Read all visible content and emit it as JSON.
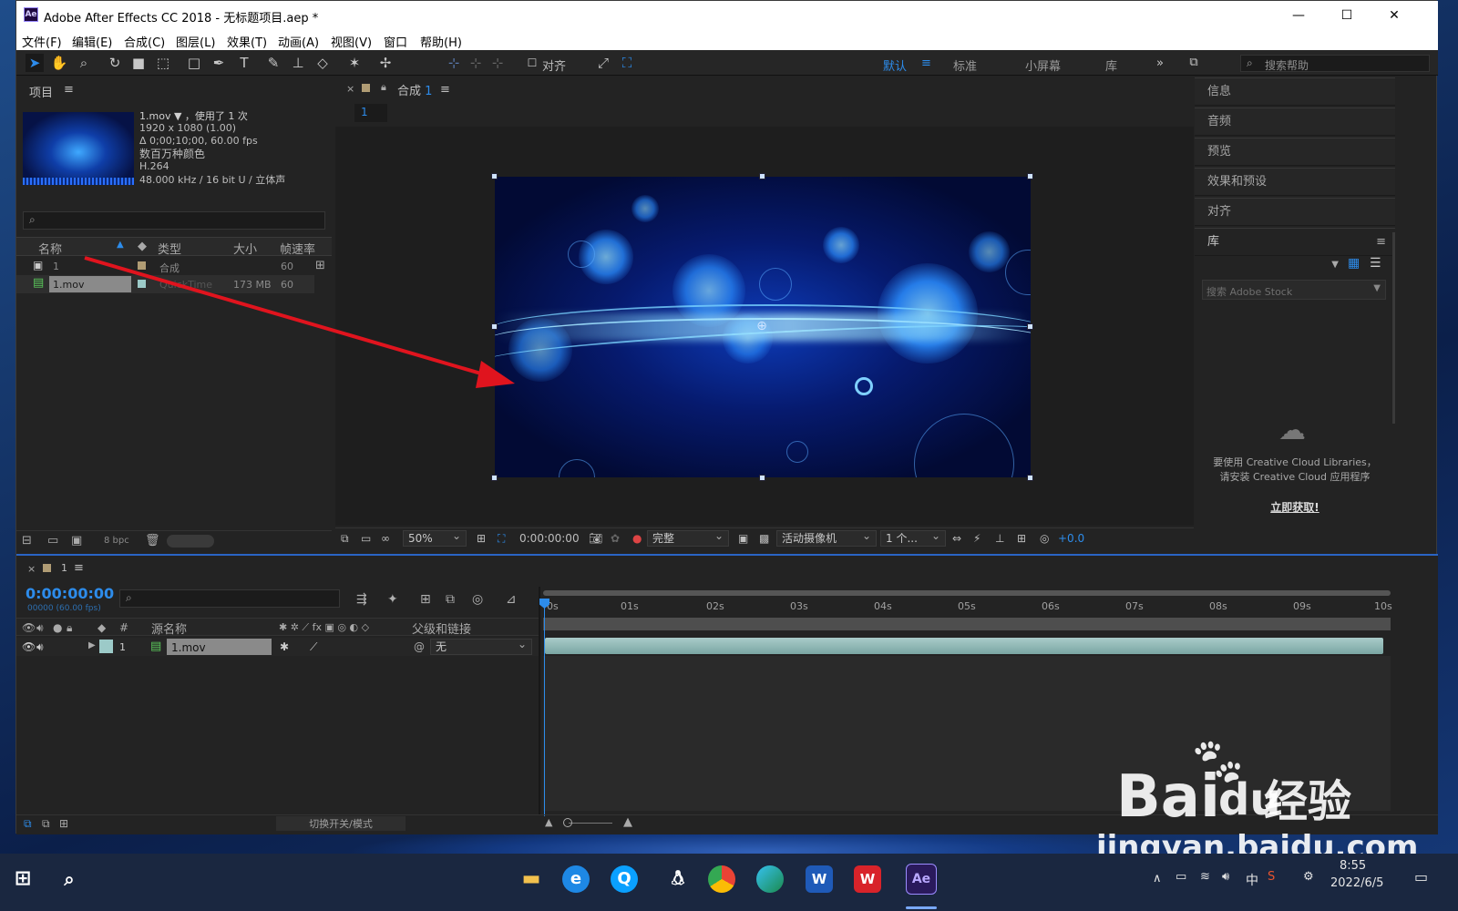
{
  "window": {
    "title": "Adobe After Effects CC 2018 - 无标题项目.aep *",
    "logo_text": "Ae",
    "controls": {
      "minimize": "—",
      "maximize": "☐",
      "close": "✕"
    }
  },
  "menu": [
    "文件(F)",
    "编辑(E)",
    "合成(C)",
    "图层(L)",
    "效果(T)",
    "动画(A)",
    "视图(V)",
    "窗口",
    "帮助(H)"
  ],
  "toolbar": {
    "align_label": "对齐",
    "workspaces": [
      "默认",
      "标准",
      "小屏幕",
      "库"
    ],
    "more": "»",
    "help_search_placeholder": "搜索帮助"
  },
  "project_panel": {
    "title": "项目",
    "footage": {
      "name": "1.mov",
      "usage": "，使用了 1 次",
      "resolution": "1920 x 1080 (1.00)",
      "duration": "Δ 0;00;10;00, 60.00 fps",
      "colors": "数百万种颜色",
      "codec": "H.264",
      "audio": "48.000 kHz / 16 bit U / 立体声"
    },
    "columns": [
      "名称",
      "类型",
      "大小",
      "帧速率"
    ],
    "items": [
      {
        "name": "1",
        "type": "合成",
        "size": "",
        "fps": "60"
      },
      {
        "name": "1.mov",
        "type": "QuickTime",
        "size": "173 MB",
        "fps": "60"
      }
    ],
    "bpc": "8 bpc"
  },
  "composition_viewer": {
    "tab_label": "合成",
    "tab_number": "1",
    "sub_tab": "1",
    "zoom": "50%",
    "timecode": "0:00:00:00",
    "resolution": "完整",
    "camera": "活动摄像机",
    "views": "1 个...",
    "exposure": "+0.0"
  },
  "right_panel": {
    "items": [
      "信息",
      "音频",
      "预览",
      "效果和预设",
      "对齐"
    ],
    "library": {
      "title": "库",
      "search_placeholder": "搜索 Adobe Stock",
      "message_line1": "要使用 Creative Cloud Libraries，",
      "message_line2": "请安装 Creative Cloud 应用程序",
      "cta": "立即获取!"
    }
  },
  "timeline": {
    "tab_number": "1",
    "timecode": "0:00:00:00",
    "frame_info": "00000 (60.00 fps)",
    "columns": {
      "source_name": "源名称",
      "parent": "父级和链接"
    },
    "layer": {
      "number": "1",
      "name": "1.mov",
      "parent": "无"
    },
    "ruler": [
      "0s",
      "01s",
      "02s",
      "03s",
      "04s",
      "05s",
      "06s",
      "07s",
      "08s",
      "09s",
      "10s"
    ],
    "footer_toggle": "切换开关/模式"
  },
  "taskbar": {
    "time": "8:55",
    "date": "2022/6/5",
    "ime": "中",
    "apps": [
      "file-explorer",
      "ie",
      "qq-browser",
      "qq",
      "chrome",
      "edge",
      "word",
      "wps",
      "after-effects"
    ]
  },
  "watermark": {
    "brand": "Bai",
    "du": "du",
    "jingyan": "经验",
    "url": "jingyan.baidu.com"
  },
  "colors": {
    "accent": "#2d8ceb",
    "timeline_border": "#2a64c4",
    "arrow": "#e0141e"
  }
}
